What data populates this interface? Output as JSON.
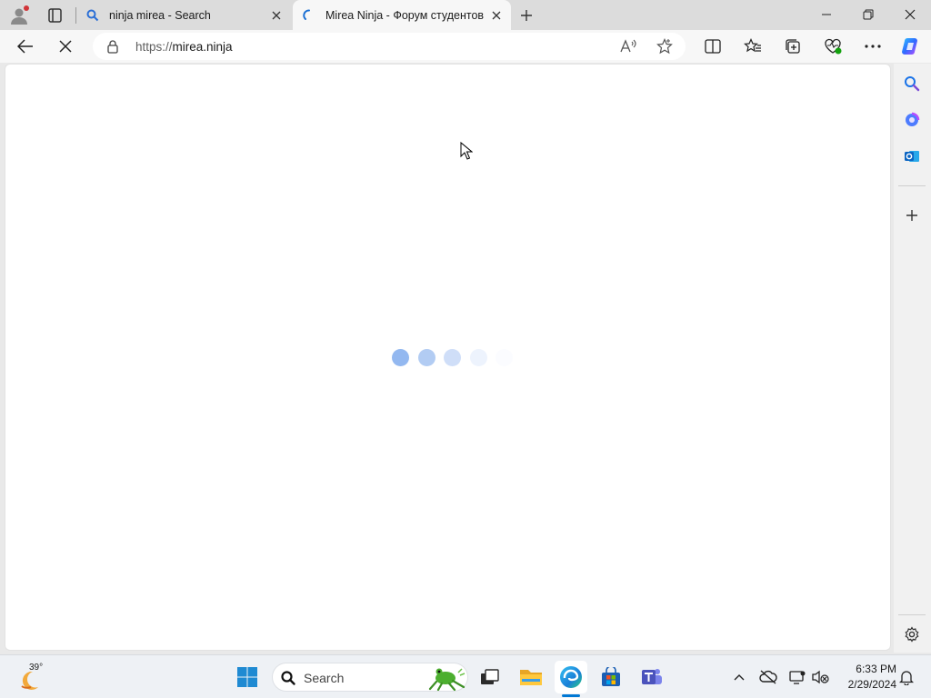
{
  "tabs": [
    {
      "title": "ninja mirea - Search",
      "favicon": "search-icon",
      "active": false
    },
    {
      "title": "Mirea Ninja - Форум студентов",
      "favicon": "loading-spinner-icon",
      "active": true
    }
  ],
  "address_bar": {
    "url_scheme": "https://",
    "url_host": "mirea.ninja"
  },
  "page": {
    "state": "loading",
    "loader_colors": [
      "#93b8f0",
      "#b2ccf3",
      "#cfdef8",
      "#edf3fd",
      "#fbfcff"
    ]
  },
  "colors": {
    "accent": "#0078d4",
    "tabstrip_bg": "#dcdcdc",
    "toolbar_bg": "#f7f7f7",
    "taskbar_bg": "#eef1f5"
  },
  "taskbar": {
    "weather_temp": "39°",
    "search_label": "Search",
    "apps": [
      "windows-start-icon",
      "task-view-icon",
      "file-explorer-icon",
      "edge-icon",
      "microsoft-store-icon",
      "teams-icon"
    ],
    "clock_time": "6:33 PM",
    "clock_date": "2/29/2024"
  }
}
